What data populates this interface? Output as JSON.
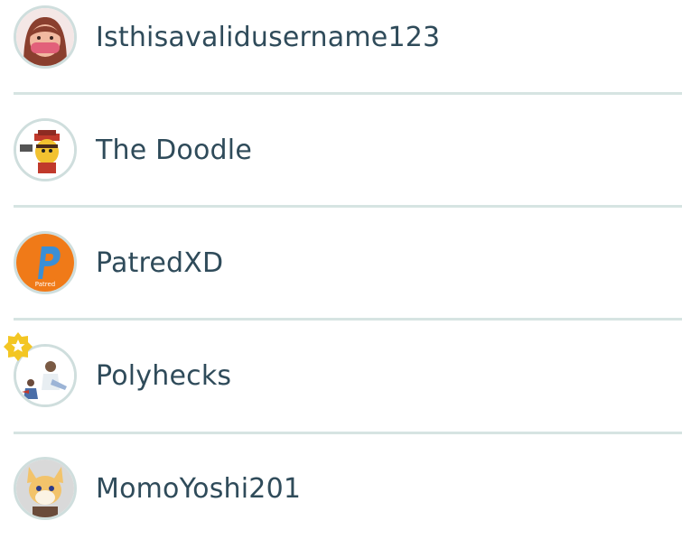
{
  "users": [
    {
      "name": "Isthisavalidusername123",
      "avatar_icon": "girl-face-avatar-icon",
      "badge": null
    },
    {
      "name": "The Doodle",
      "avatar_icon": "red-cap-character-avatar-icon",
      "badge": null
    },
    {
      "name": "PatredXD",
      "avatar_icon": "orange-p-logo-avatar-icon",
      "badge": null
    },
    {
      "name": "Polyhecks",
      "avatar_icon": "figures-avatar-icon",
      "badge": "star-badge-icon"
    },
    {
      "name": "MomoYoshi201",
      "avatar_icon": "fox-character-avatar-icon",
      "badge": null
    }
  ],
  "colors": {
    "username_text": "#2f4b5a",
    "divider": "#d6e4e2",
    "avatar_ring": "#cfdedd",
    "badge_gold": "#f3c623"
  }
}
